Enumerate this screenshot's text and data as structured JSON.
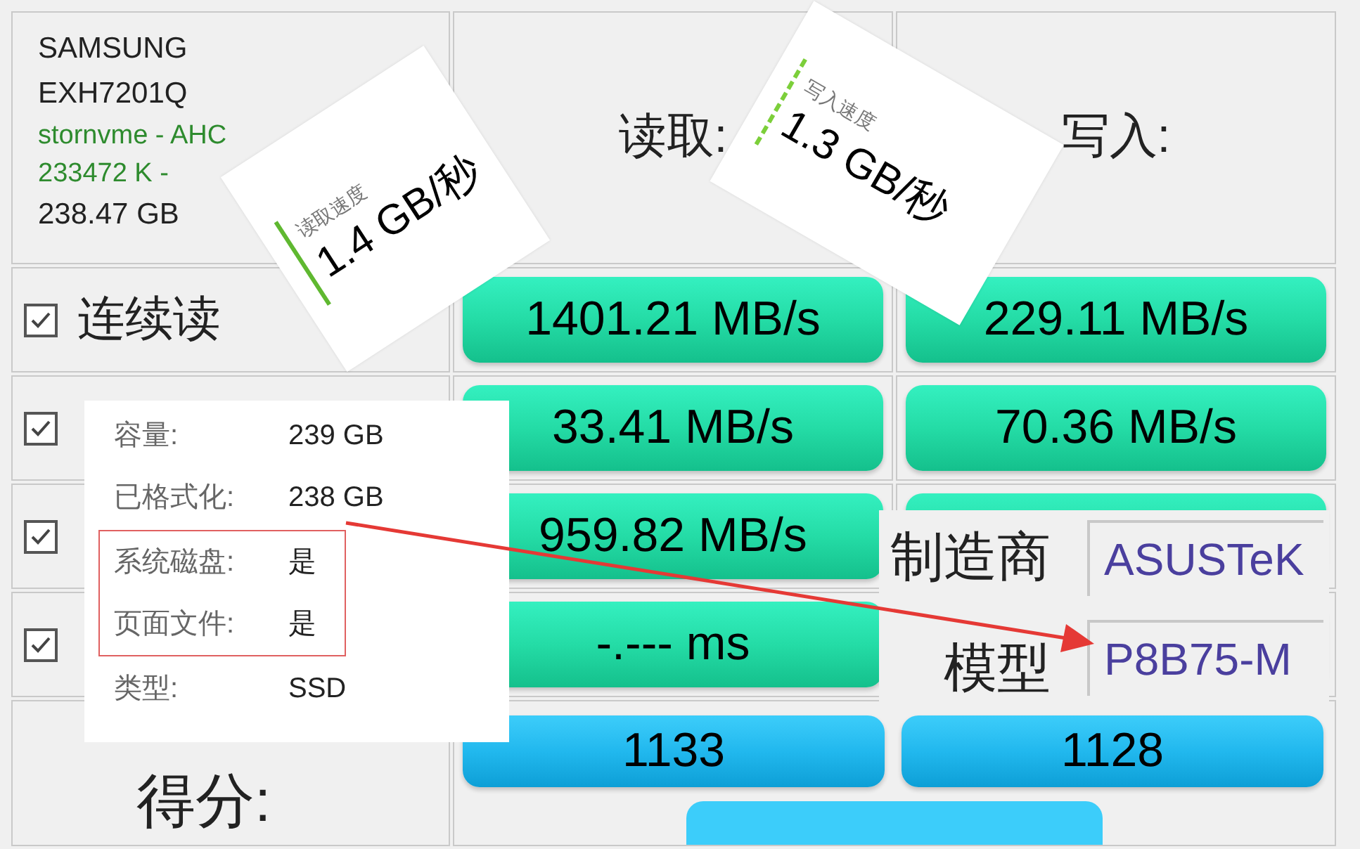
{
  "drive": {
    "lines": [
      {
        "text": "SAMSUNG",
        "kind": "name"
      },
      {
        "text": "EXH7201Q",
        "kind": "name"
      },
      {
        "text": "stornvme - AHC",
        "kind": "driver"
      },
      {
        "text": "233472 K -",
        "kind": "driver"
      },
      {
        "text": "238.47 GB",
        "kind": "name"
      }
    ]
  },
  "columns": [
    {
      "label": "读取:"
    },
    {
      "label": "写入:"
    }
  ],
  "rows": [
    {
      "label": "连续读",
      "checked": true,
      "read": "1401.21 MB/s",
      "write": "229.11 MB/s"
    },
    {
      "checked": true,
      "read": "33.41 MB/s",
      "write": "70.36 MB/s"
    },
    {
      "checked": true,
      "read": "959.82 MB/s"
    },
    {
      "checked": true,
      "read": "-.--- ms"
    }
  ],
  "score": {
    "label": "得分:",
    "read": "1133",
    "write": "1128"
  },
  "speed_cards": [
    {
      "caption": "读取速度",
      "value": "1.4 GB/秒",
      "kind": "solid"
    },
    {
      "caption": "写入速度",
      "value": "1.3 GB/秒",
      "kind": "dashed"
    }
  ],
  "disk_info": [
    {
      "label": "容量:",
      "value": "239 GB",
      "highlighted": false
    },
    {
      "label": "已格式化:",
      "value": "238 GB",
      "highlighted": false
    },
    {
      "label": "系统磁盘:",
      "value": "是",
      "highlighted": true
    },
    {
      "label": "页面文件:",
      "value": "是",
      "highlighted": true
    },
    {
      "label": "类型:",
      "value": "SSD",
      "highlighted": false
    }
  ],
  "board": [
    {
      "label": "制造商",
      "value": "ASUSTeK"
    },
    {
      "label": "模型",
      "value": "P8B75-M"
    }
  ]
}
